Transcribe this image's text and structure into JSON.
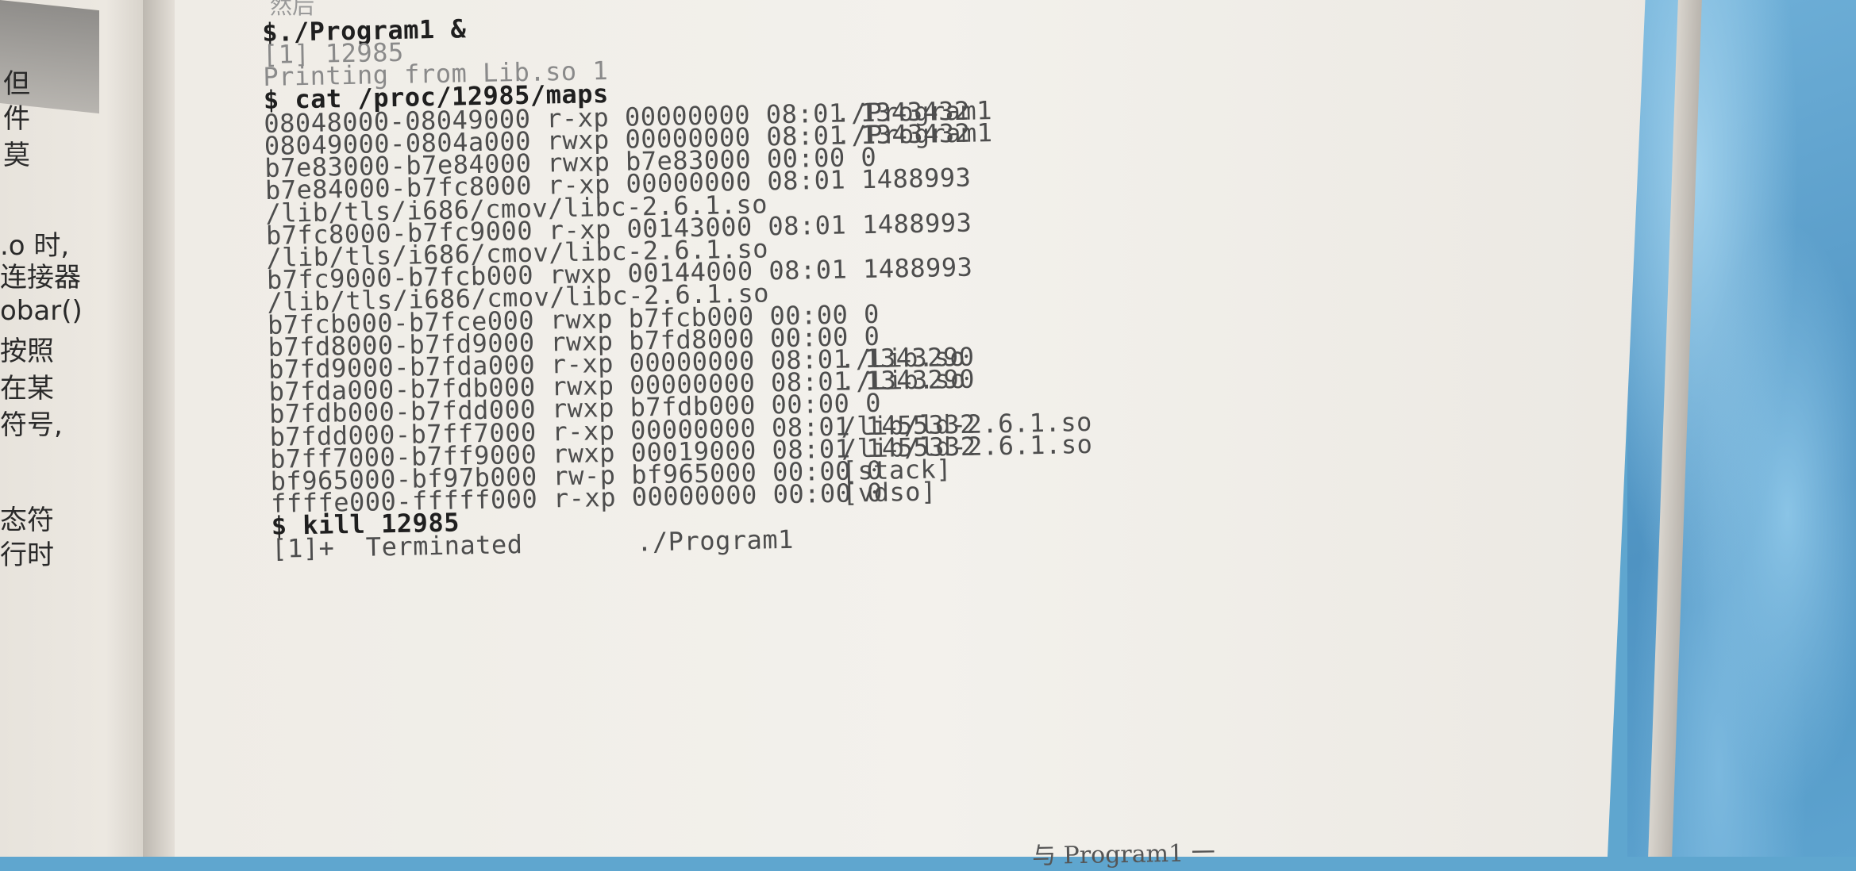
{
  "left_page": {
    "fragments": [
      "但",
      "件",
      "莫",
      ".o 时,",
      "连接器",
      "obar()",
      "按照",
      "在某",
      "符号,",
      "态符",
      "行时"
    ]
  },
  "top_fragment": "然后",
  "terminal": {
    "lines": [
      {
        "text": "$./Program1 &",
        "kind": "cmd"
      },
      {
        "text": "[1] 12985",
        "kind": "faint"
      },
      {
        "text": "Printing from Lib.so 1",
        "kind": "faint"
      },
      {
        "text": "$ cat /proc/12985/maps",
        "kind": "cmd"
      },
      {
        "text": "08048000-08049000 r-xp 00000000 08:01 1343432",
        "path": "./Program1"
      },
      {
        "text": "08049000-0804a000 rwxp 00000000 08:01 1343432",
        "path": "./Program1"
      },
      {
        "text": "b7e83000-b7e84000 rwxp b7e83000 00:00 0",
        "path": ""
      },
      {
        "text": "b7e84000-b7fc8000 r-xp 00000000 08:01 1488993",
        "path": ""
      },
      {
        "text": "/lib/tls/i686/cmov/libc-2.6.1.so",
        "path": ""
      },
      {
        "text": "b7fc8000-b7fc9000 r-xp 00143000 08:01 1488993",
        "path": ""
      },
      {
        "text": "/lib/tls/i686/cmov/libc-2.6.1.so",
        "path": ""
      },
      {
        "text": "b7fc9000-b7fcb000 rwxp 00144000 08:01 1488993",
        "path": ""
      },
      {
        "text": "/lib/tls/i686/cmov/libc-2.6.1.so",
        "path": ""
      },
      {
        "text": "b7fcb000-b7fce000 rwxp b7fcb000 00:00 0",
        "path": ""
      },
      {
        "text": "b7fd8000-b7fd9000 rwxp b7fd8000 00:00 0",
        "path": ""
      },
      {
        "text": "b7fd9000-b7fda000 r-xp 00000000 08:01 1343290",
        "path": "./Lib.so"
      },
      {
        "text": "b7fda000-b7fdb000 rwxp 00000000 08:01 1343290",
        "path": "./Lib.so"
      },
      {
        "text": "b7fdb000-b7fdd000 rwxp b7fdb000 00:00 0",
        "path": ""
      },
      {
        "text": "b7fdd000-b7ff7000 r-xp 00000000 08:01 1455332",
        "path": "/lib/ld-2.6.1.so"
      },
      {
        "text": "b7ff7000-b7ff9000 rwxp 00019000 08:01 1455332",
        "path": "/lib/ld-2.6.1.so"
      },
      {
        "text": "bf965000-bf97b000 rw-p bf965000 00:00 0",
        "path": "[stack]"
      },
      {
        "text": "ffffe000-fffff000 r-xp 00000000 00:00 0",
        "path": "[vdso]"
      },
      {
        "text": "$ kill 12985",
        "kind": "cmd"
      },
      {
        "text": "[1]+  Terminated",
        "path": "./Program1"
      }
    ]
  },
  "bottom_fragment": "与 Program1 一"
}
